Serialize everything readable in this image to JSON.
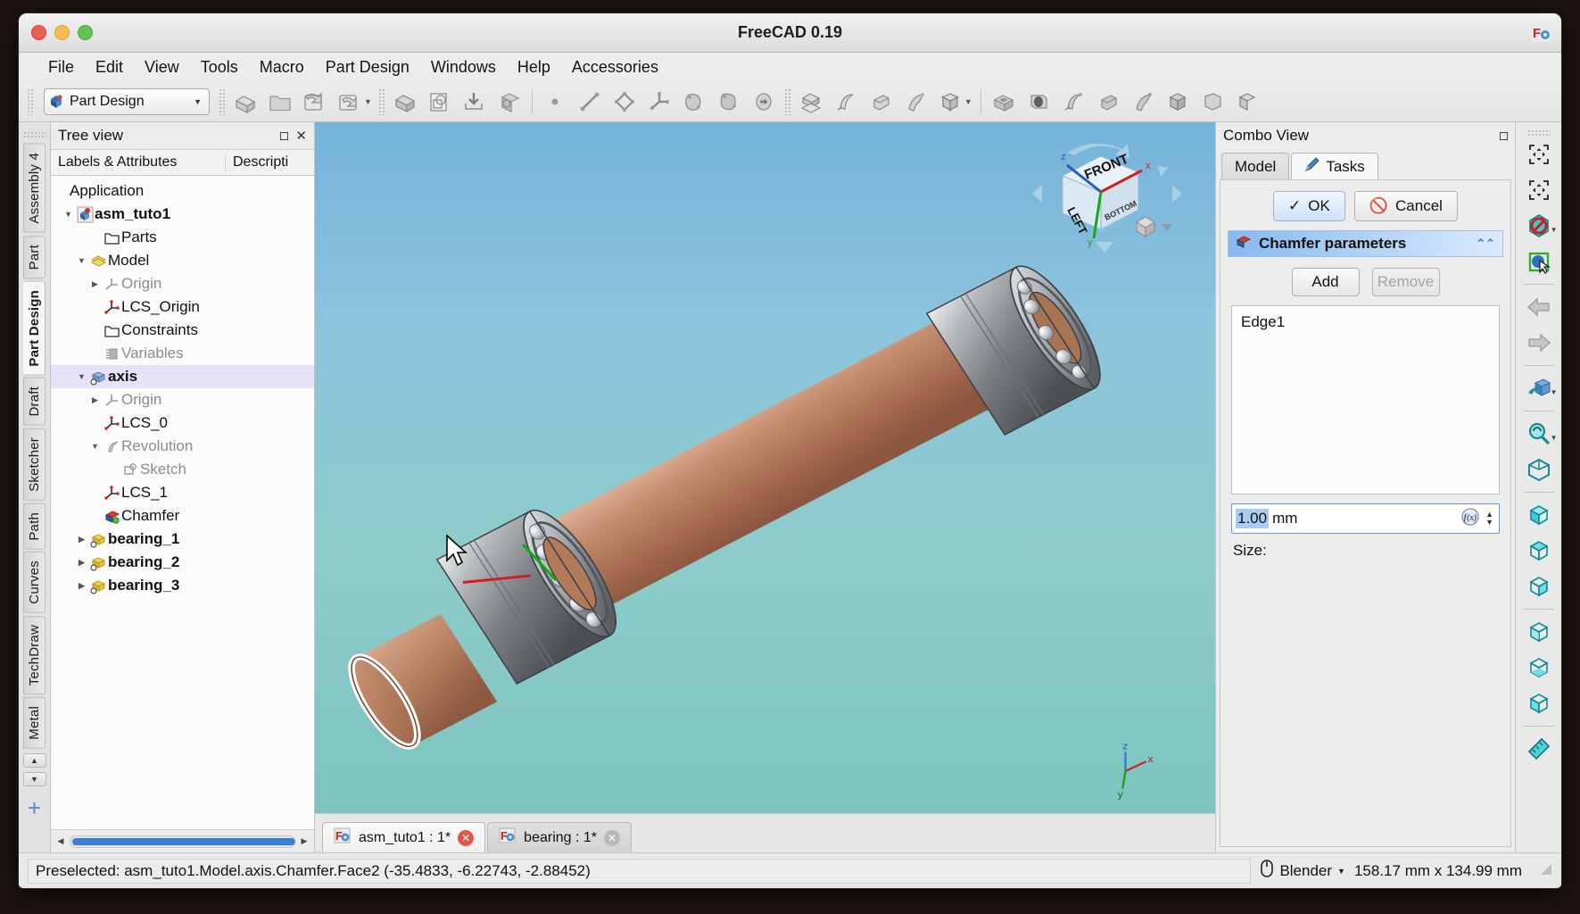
{
  "window": {
    "title": "FreeCAD 0.19"
  },
  "menubar": [
    "File",
    "Edit",
    "View",
    "Tools",
    "Macro",
    "Part Design",
    "Windows",
    "Help",
    "Accessories"
  ],
  "toolbar": {
    "workbench": "Part Design",
    "icons": [
      "new-document-icon",
      "open-folder-icon",
      "save-icon",
      "save-as-icon",
      "refresh-icon",
      "std-view-icon",
      "import-icon",
      "export-icon",
      "point-icon",
      "line-icon",
      "polygon-icon",
      "datum-icon",
      "shape-binder-icon",
      "sub-shape-binder-icon",
      "clone-icon",
      "sheep-icon",
      "pad-icon",
      "revolution-icon",
      "additive-loft-icon",
      "additive-pipe-icon",
      "additive-helix-icon",
      "additive-box-icon",
      "pocket-icon",
      "hole-icon",
      "groove-icon",
      "subtractive-loft-icon",
      "subtractive-pipe-icon",
      "subtractive-box-icon",
      "fillet-icon",
      "chamfer-icon",
      "draft-icon",
      "thickness-icon"
    ]
  },
  "workbench_tabs": {
    "items": [
      "Assembly 4",
      "Part",
      "Part Design",
      "Draft",
      "Sketcher",
      "Path",
      "Curves",
      "TechDraw",
      "Metal"
    ],
    "active": "Part Design",
    "add_label": "+"
  },
  "tree_panel": {
    "title": "Tree view",
    "columns": [
      "Labels & Attributes",
      "Descripti"
    ],
    "items": [
      {
        "label": "Application",
        "indent": 0,
        "arrow": "",
        "icon": "",
        "state": "normal"
      },
      {
        "label": "asm_tuto1",
        "indent": 1,
        "arrow": "down",
        "icon": "assembly-icon",
        "state": "bold"
      },
      {
        "label": "Parts",
        "indent": 2,
        "arrow": "",
        "icon": "folder-icon",
        "state": "normal"
      },
      {
        "label": "Model",
        "indent": 2,
        "arrow": "down",
        "icon": "model-group-icon",
        "state": "normal"
      },
      {
        "label": "Origin",
        "indent": 3,
        "arrow": "right",
        "icon": "origin-icon",
        "state": "dim"
      },
      {
        "label": "LCS_Origin",
        "indent": 3,
        "arrow": "",
        "icon": "lcs-icon",
        "state": "normal"
      },
      {
        "label": "Constraints",
        "indent": 3,
        "arrow": "",
        "icon": "folder-icon",
        "state": "normal"
      },
      {
        "label": "Variables",
        "indent": 3,
        "arrow": "",
        "icon": "variables-icon",
        "state": "dim"
      },
      {
        "label": "axis",
        "indent": 2,
        "arrow": "down",
        "icon": "part-link-icon",
        "state": "selected"
      },
      {
        "label": "Origin",
        "indent": 3,
        "arrow": "right",
        "icon": "origin-icon",
        "state": "dim"
      },
      {
        "label": "LCS_0",
        "indent": 3,
        "arrow": "",
        "icon": "lcs-icon",
        "state": "normal"
      },
      {
        "label": "Revolution",
        "indent": 3,
        "arrow": "down",
        "icon": "revolution-icon",
        "state": "dim"
      },
      {
        "label": "Sketch",
        "indent": 4,
        "arrow": "",
        "icon": "sketch-icon",
        "state": "dim"
      },
      {
        "label": "LCS_1",
        "indent": 3,
        "arrow": "",
        "icon": "lcs-icon",
        "state": "normal"
      },
      {
        "label": "Chamfer",
        "indent": 3,
        "arrow": "",
        "icon": "chamfer-icon",
        "state": "normal"
      },
      {
        "label": "bearing_1",
        "indent": 2,
        "arrow": "right",
        "icon": "part-link-icon",
        "state": "normal"
      },
      {
        "label": "bearing_2",
        "indent": 2,
        "arrow": "right",
        "icon": "part-link-icon",
        "state": "normal"
      },
      {
        "label": "bearing_3",
        "indent": 2,
        "arrow": "right",
        "icon": "part-link-icon",
        "state": "normal"
      }
    ]
  },
  "combo_view": {
    "title": "Combo View",
    "tabs": [
      {
        "label": "Model",
        "icon": "",
        "active": false
      },
      {
        "label": "Tasks",
        "icon": "pencil-icon",
        "active": true
      }
    ],
    "ok_label": "OK",
    "cancel_label": "Cancel",
    "section_title": "Chamfer parameters",
    "add_label": "Add",
    "remove_label": "Remove",
    "remove_disabled": true,
    "edge_list": [
      "Edge1"
    ],
    "size_value": "1.00",
    "size_unit": "mm",
    "size_label": "Size:",
    "expression_icon": "fx-icon"
  },
  "document_tabs": [
    {
      "label": "asm_tuto1 : 1*",
      "active": true
    },
    {
      "label": "bearing : 1*",
      "active": false
    }
  ],
  "nav_cube": {
    "front_label": "FRONT",
    "left_label": "LEFT",
    "bottom_label": "BOTTOM",
    "axis_x": "x",
    "axis_y": "y",
    "axis_z": "z"
  },
  "viewport_axes": {
    "x": "x",
    "y": "y",
    "z": "z"
  },
  "right_toolbar": {
    "icons": [
      "fit-all-icon",
      "fit-selection-icon",
      "draw-style-icon",
      "selection-view-icon",
      "back-arrow-icon",
      "forward-arrow-icon",
      "rotate-view-icon",
      "zoom-icon",
      "axonometric-view-icon",
      "front-view-icon",
      "top-view-icon",
      "right-view-icon",
      "rear-view-icon",
      "bottom-view-icon",
      "left-view-icon",
      "measure-icon"
    ]
  },
  "statusbar": {
    "message": "Preselected: asm_tuto1.Model.axis.Chamfer.Face2 (-35.4833, -6.22743, -2.88452)",
    "nav_mode": "Blender",
    "dimensions": "158.17 mm x 134.99 mm",
    "mouse_icon": "mouse-icon"
  },
  "colors": {
    "shaft": "#c08a6e",
    "bearing": "#8d8f91",
    "highlight_edge": "#ffffff",
    "accent": "#3a7fd5",
    "selection": "#a8cdf0"
  }
}
